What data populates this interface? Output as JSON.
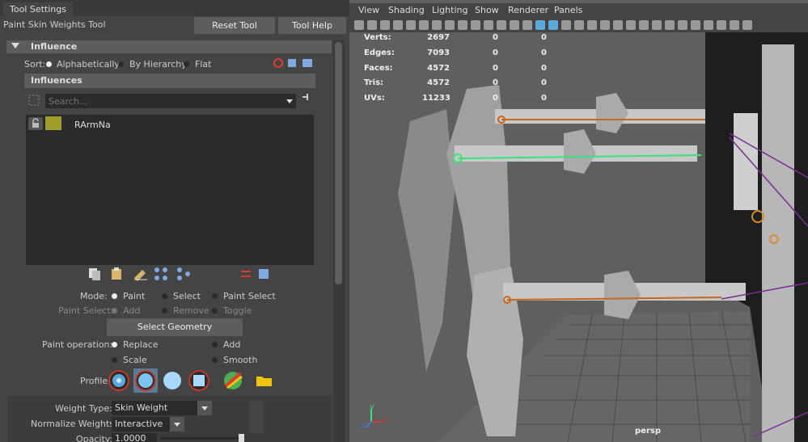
{
  "panel": {
    "tab_title": "Tool Settings",
    "tool_name": "Paint Skin Weights Tool",
    "reset_button": "Reset Tool",
    "help_button": "Tool Help"
  },
  "influence": {
    "frame_title": "Influence",
    "sort_label": "Sort:",
    "sort_options": [
      "Alphabetically",
      "By Hierarchy",
      "Flat"
    ],
    "sort_selected": "Alphabetically",
    "list_title": "Influences",
    "search_placeholder": "Search...",
    "items": [
      {
        "name": "RArmNa",
        "color": "#9e9e2a"
      }
    ]
  },
  "mode": {
    "label": "Mode:",
    "options": [
      "Paint",
      "Select",
      "Paint Select"
    ],
    "selected": "Paint"
  },
  "paint_select": {
    "label": "Paint Select:",
    "options": [
      "Add",
      "Remove",
      "Toggle"
    ],
    "selected": "Add"
  },
  "select_geometry_button": "Select Geometry",
  "paint_operation": {
    "label": "Paint operation:",
    "options": [
      "Replace",
      "Add",
      "Scale",
      "Smooth"
    ],
    "selected": "Replace"
  },
  "profile_label": "Profile:",
  "weight_type": {
    "label": "Weight Type:",
    "value": "Skin Weight"
  },
  "normalize_weights": {
    "label": "Normalize Weights:",
    "value": "Interactive"
  },
  "opacity": {
    "label": "Opacity:",
    "value": "1.0000"
  },
  "viewport": {
    "menus": [
      "View",
      "Shading",
      "Lighting",
      "Show",
      "Renderer",
      "Panels"
    ],
    "hud": [
      {
        "label": "Verts:",
        "v1": "2697",
        "v2": "0",
        "v3": "0"
      },
      {
        "label": "Edges:",
        "v1": "7093",
        "v2": "0",
        "v3": "0"
      },
      {
        "label": "Faces:",
        "v1": "4572",
        "v2": "0",
        "v3": "0"
      },
      {
        "label": "Tris:",
        "v1": "4572",
        "v2": "0",
        "v3": "0"
      },
      {
        "label": "UVs:",
        "v1": "11233",
        "v2": "0",
        "v3": "0"
      }
    ],
    "camera_label": "persp",
    "axis": {
      "x": "x",
      "y": "y",
      "z": "z"
    }
  },
  "colors": {
    "highlight_joint": "#39e27a",
    "joint": "#c8661c",
    "accent": "#5aa9d9"
  }
}
